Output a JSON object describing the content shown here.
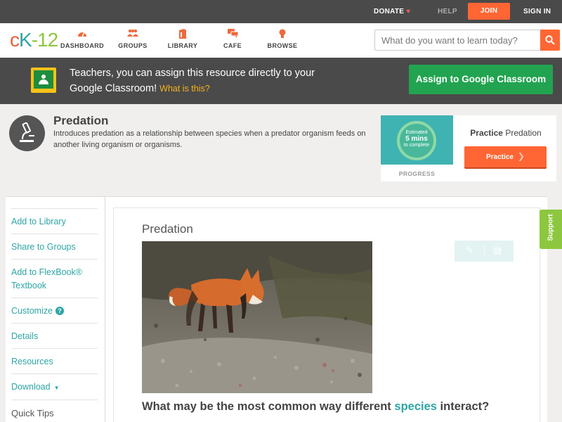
{
  "topbar": {
    "donate": "DONATE",
    "help": "HELP",
    "join": "JOIN",
    "signin": "SIGN IN"
  },
  "brand": {
    "logo_c": "c",
    "logo_k": "K",
    "logo_num": "-12"
  },
  "nav": {
    "dashboard": "DASHBOARD",
    "groups": "GROUPS",
    "library": "LIBRARY",
    "cafe": "CAFE",
    "browse": "BROWSE"
  },
  "search": {
    "placeholder": "What do you want to learn today?"
  },
  "classroom": {
    "message": "Teachers, you can assign this resource directly to your Google Classroom!",
    "link": "What is this?",
    "button": "Assign to Google Classroom"
  },
  "lesson": {
    "title": "Predation",
    "description": "Introduces predation as a relationship between species when a predator organism feeds on another living organism or organisms."
  },
  "practice": {
    "estimated": "Estimated",
    "mins": "5 mins",
    "to_complete": "to complete",
    "progress": "PROGRESS",
    "label_bold": "Practice",
    "label_rest": "Predation",
    "button": "Practice"
  },
  "sidebar": {
    "items": [
      {
        "label": "Add to Library"
      },
      {
        "label": "Share to Groups"
      },
      {
        "label": "Add to FlexBook® Textbook"
      },
      {
        "label": "Customize"
      },
      {
        "label": "Details"
      },
      {
        "label": "Resources"
      },
      {
        "label": "Download"
      },
      {
        "label": "Quick Tips"
      }
    ]
  },
  "article": {
    "title": "Predation",
    "question_pre": "What may be the most common way different",
    "question_kw": "species",
    "question_post": "interact?"
  },
  "support": {
    "label": "Support"
  },
  "colors": {
    "accent_orange": "#ff6633",
    "accent_teal": "#2fa5a6",
    "accent_green": "#22a34f",
    "support_green": "#8dc63f",
    "dark_bar": "#4a4a4a"
  }
}
